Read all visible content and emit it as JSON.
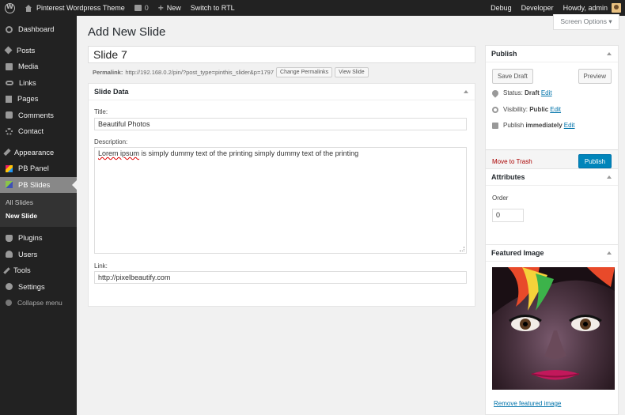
{
  "admin_bar": {
    "site_name": "Pinterest Wordpress Theme",
    "comments_count": "0",
    "new_label": "New",
    "rtl_label": "Switch to RTL",
    "debug_label": "Debug",
    "developer_label": "Developer",
    "howdy_label": "Howdy, admin"
  },
  "sidebar": {
    "items": [
      {
        "label": "Dashboard",
        "icon": "dashboard-icon"
      },
      {
        "label": "Posts",
        "icon": "pin-icon"
      },
      {
        "label": "Media",
        "icon": "media-icon"
      },
      {
        "label": "Links",
        "icon": "link-icon"
      },
      {
        "label": "Pages",
        "icon": "page-icon"
      },
      {
        "label": "Comments",
        "icon": "comment-icon"
      },
      {
        "label": "Contact",
        "icon": "contact-icon"
      },
      {
        "label": "Appearance",
        "icon": "brush-icon"
      },
      {
        "label": "PB Panel",
        "icon": "pb-panel-icon"
      },
      {
        "label": "PB Slides",
        "icon": "pb-slides-icon"
      },
      {
        "label": "Plugins",
        "icon": "plugin-icon"
      },
      {
        "label": "Users",
        "icon": "users-icon"
      },
      {
        "label": "Tools",
        "icon": "tools-icon"
      },
      {
        "label": "Settings",
        "icon": "settings-icon"
      }
    ],
    "submenu": [
      "All Slides",
      "New Slide"
    ],
    "collapse_label": "Collapse menu"
  },
  "main": {
    "page_title": "Add New Slide",
    "screen_options": "Screen Options ▾",
    "title_value": "Slide 7",
    "permalink_label": "Permalink:",
    "permalink_url": "http://192.168.0.2/pin/?post_type=pinthis_slider&p=1797",
    "change_permalinks": "Change Permalinks",
    "view_slide": "View Slide",
    "slide_data": {
      "header": "Slide Data",
      "title_label": "Title:",
      "title_value": "Beautiful Photos",
      "description_label": "Description:",
      "description_wavy": "Lorem ipsum",
      "description_rest": " is simply dummy text of the printing simply dummy text of the printing",
      "link_label": "Link:",
      "link_value": "http://pixelbeautify.com"
    }
  },
  "publish": {
    "header": "Publish",
    "save_draft": "Save Draft",
    "preview": "Preview",
    "status_label": "Status:",
    "status_value": "Draft",
    "visibility_label": "Visibility:",
    "visibility_value": "Public",
    "publish_label": "Publish",
    "publish_value": "immediately",
    "edit": "Edit",
    "trash": "Move to Trash",
    "publish_button": "Publish"
  },
  "attributes": {
    "header": "Attributes",
    "order_label": "Order",
    "order_value": "0"
  },
  "featured_image": {
    "header": "Featured Image",
    "remove_label": "Remove featured image"
  },
  "colors": {
    "accent": "#0085ba",
    "admin_bar": "#222222",
    "current_menu": "#888888"
  }
}
